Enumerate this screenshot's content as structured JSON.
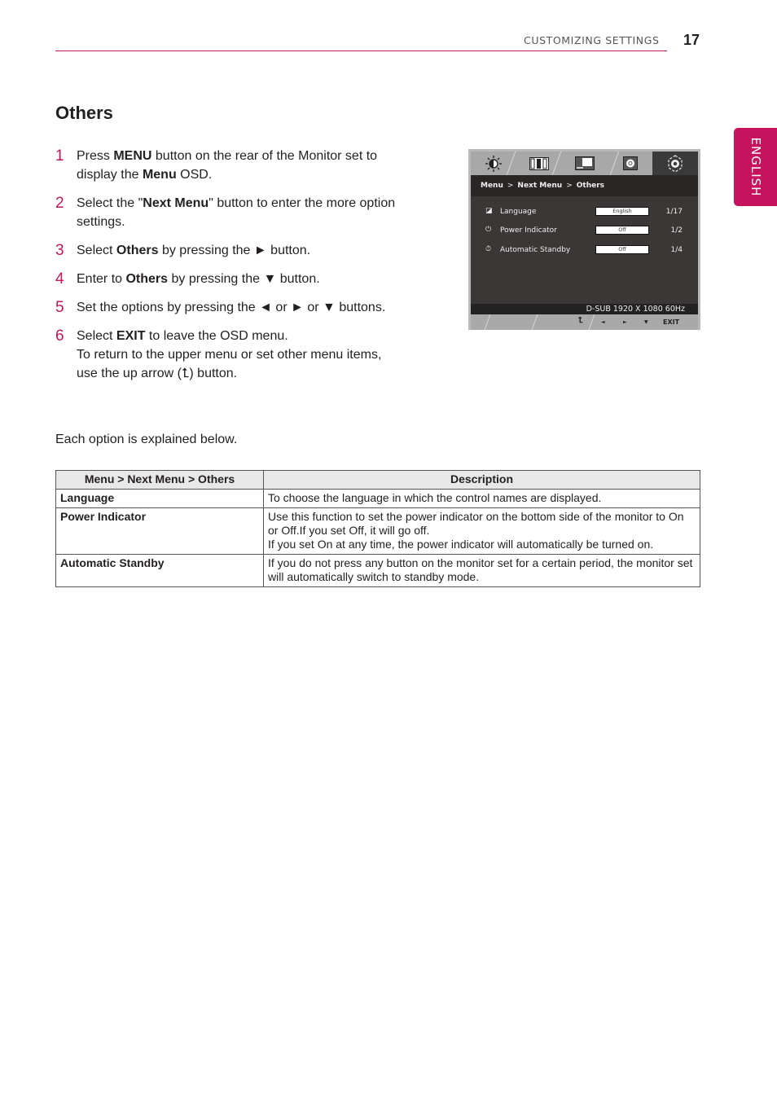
{
  "header": {
    "section": "CUSTOMIZING SETTINGS",
    "page_number": "17",
    "accent_color": "#c6135e"
  },
  "language_tab": "ENGLISH",
  "title": "Others",
  "steps": [
    {
      "num": "1",
      "parts": [
        [
          "Press ",
          false
        ],
        [
          "MENU",
          true
        ],
        [
          " button on the rear of the Monitor set to display the ",
          false
        ],
        [
          "Menu",
          true
        ],
        [
          " OSD.",
          false
        ]
      ]
    },
    {
      "num": "2",
      "parts": [
        [
          "Select the \"",
          false
        ],
        [
          "Next Menu",
          true
        ],
        [
          "\" button to enter the more option settings.",
          false
        ]
      ]
    },
    {
      "num": "3",
      "parts": [
        [
          "Select ",
          false
        ],
        [
          "Others",
          true
        ],
        [
          " by pressing the ► button.",
          false
        ]
      ]
    },
    {
      "num": "4",
      "parts": [
        [
          "Enter to ",
          false
        ],
        [
          "Others",
          true
        ],
        [
          " by pressing the ▼ button.",
          false
        ]
      ]
    },
    {
      "num": "5",
      "parts": [
        [
          "Set the options by pressing the ◄ or ► or ▼ buttons.",
          false
        ]
      ]
    },
    {
      "num": "6",
      "parts": [
        [
          "Select ",
          false
        ],
        [
          "EXIT",
          true
        ],
        [
          " to leave the OSD menu.",
          false
        ]
      ],
      "extra": "To return to the upper menu or set other menu items, use the up arrow (⮤) button."
    }
  ],
  "explain": "Each option is explained below.",
  "table": {
    "headers": [
      "Menu > Next Menu > Others",
      "Description"
    ],
    "rows": [
      {
        "key": "Language",
        "desc": [
          "To choose the language in which the control names are displayed."
        ]
      },
      {
        "key": "Power Indicator",
        "desc": [
          "Use this function to set the power indicator on the bottom side of the monitor to On or Off.If you set Off, it will go off.",
          "If you set On at any time, the power indicator will automatically be turned on."
        ]
      },
      {
        "key": "Automatic Standby",
        "desc": [
          "If you do not press any button on the monitor set for a certain period, the monitor set will automatically switch to standby mode."
        ]
      }
    ]
  },
  "osd": {
    "tabs": [
      "brightness-icon",
      "picture-icon",
      "screen-icon",
      "color-icon",
      "settings-icon"
    ],
    "active_tab": 4,
    "breadcrumb": [
      "Menu",
      "Next Menu",
      "Others"
    ],
    "breadcrumb_sep": ">",
    "rows": [
      {
        "icon": "language-icon",
        "glyph": "◪",
        "label": "Language",
        "value": "English",
        "count": "1/17"
      },
      {
        "icon": "power-indicator-icon",
        "glyph": "⏻",
        "label": "Power Indicator",
        "value": "Off",
        "count": "1/2"
      },
      {
        "icon": "standby-timer-icon",
        "glyph": "⏱",
        "label": "Automatic Standby",
        "value": "Off",
        "count": "1/4"
      }
    ],
    "status": "D-SUB 1920 X 1080 60Hz",
    "buttons": [
      {
        "name": "up-arrow",
        "glyph": "⮤"
      },
      {
        "name": "left",
        "glyph": "◄"
      },
      {
        "name": "right",
        "glyph": "►"
      },
      {
        "name": "down",
        "glyph": "▼"
      },
      {
        "name": "exit",
        "glyph": "EXIT"
      }
    ]
  }
}
